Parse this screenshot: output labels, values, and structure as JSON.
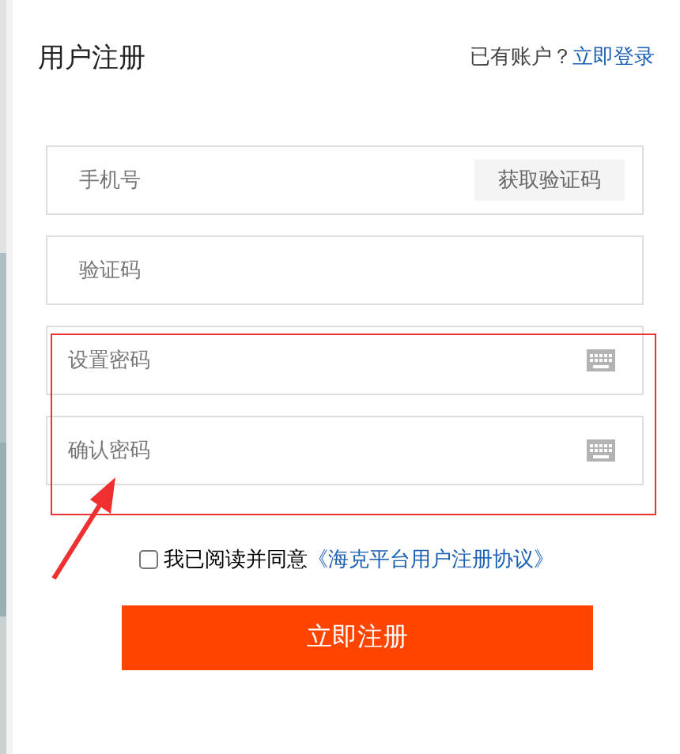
{
  "title": "用户注册",
  "login_prompt": {
    "text": "已有账户？",
    "link": "立即登录"
  },
  "fields": [
    {
      "kind": "code-request",
      "placeholder": "手机号",
      "action": "获取验证码"
    },
    {
      "kind": "plain",
      "placeholder": "验证码"
    },
    {
      "kind": "password",
      "placeholder": "设置密码"
    },
    {
      "kind": "password",
      "placeholder": "确认密码"
    }
  ],
  "agreement": {
    "checked": false,
    "text": "我已阅读并同意",
    "link": "《海克平台用户注册协议》"
  },
  "submit": "立即注册"
}
